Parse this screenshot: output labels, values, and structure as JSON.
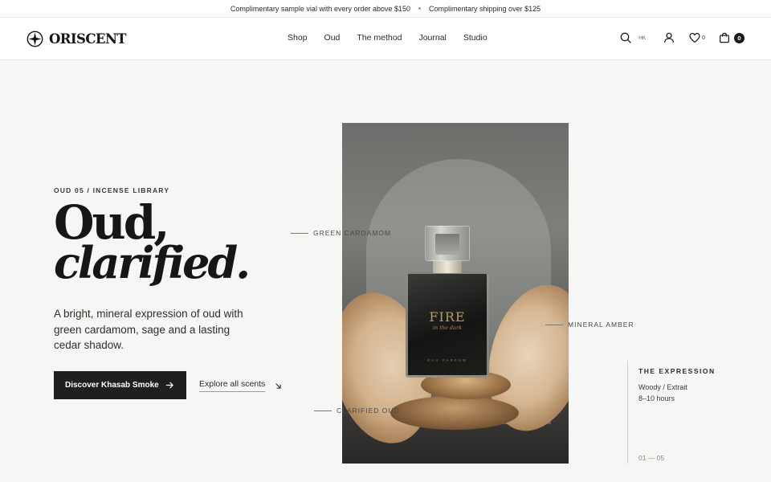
{
  "announcement": {
    "left": "Complimentary sample vial with every order above $150",
    "right": "Complimentary shipping over $125"
  },
  "brand": {
    "name": "ORISCENT"
  },
  "menu": [
    "Shop",
    "Oud",
    "The method",
    "Journal",
    "Studio"
  ],
  "header": {
    "currency": "HK",
    "wishlist_count": "0",
    "cart_count": "0"
  },
  "hero": {
    "eyebrow": "OUD 05 / INCENSE LIBRARY",
    "headline_line1": "Oud,",
    "headline_line2": "clarified.",
    "description": "A bright, mineral expression of oud with green cardamom, sage and a lasting cedar shadow.",
    "primary_cta": "Discover Khasab Smoke",
    "secondary_cta": "Explore all scents"
  },
  "product_image": {
    "label_title": "FIRE",
    "label_subtitle": "in the dark",
    "label_brand": "EAU PARFUM"
  },
  "callouts": [
    "GREEN CARDAMOM",
    "MINERAL AMBER",
    "CLARIFIED OUD"
  ],
  "expression": {
    "heading": "THE EXPRESSION",
    "type": "Woody / Extrait",
    "duration": "8–10 hours",
    "pagination": "01 — 05"
  },
  "colors": {
    "dark": "#1f1f1d",
    "background": "#f6f6f4"
  }
}
